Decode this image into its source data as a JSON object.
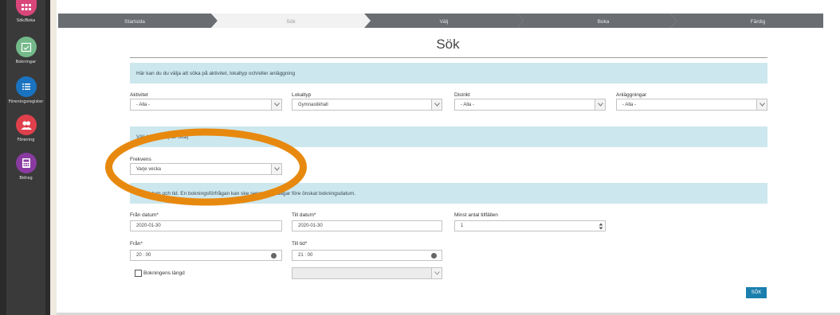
{
  "sidebar": {
    "items": [
      {
        "label": "Sök/Boka",
        "icon": "grid-icon",
        "color": "#d9477a"
      },
      {
        "label": "Bokningar",
        "icon": "calendar-check-icon",
        "color": "#74b98a"
      },
      {
        "label": "Föreningsregister",
        "icon": "list-icon",
        "color": "#1a73c0"
      },
      {
        "label": "Förening",
        "icon": "users-icon",
        "color": "#e0404c"
      },
      {
        "label": "Bidrag",
        "icon": "calculator-icon",
        "color": "#8a3ba1"
      }
    ]
  },
  "wizard": {
    "steps": [
      "Startsida",
      "Sök",
      "Välj",
      "Boka",
      "Färdig"
    ],
    "active_index": 1,
    "colors": {
      "inactive": "#6a6e73",
      "active": "#f2f2f2"
    }
  },
  "page": {
    "title": "Sök"
  },
  "info": {
    "intro": "Här kan du du välja att söka på aktivitet, lokaltyp och/eller anläggning",
    "frequency": "Välj frekvens (hur ofta)",
    "date_time": "Välj datum och tid. En bokningsförfrågan kan ske senast fem dagar före önskat bokningsdatum."
  },
  "filters": {
    "aktivitet": {
      "label": "Aktivitet",
      "value": "- Alla -"
    },
    "lokaltyp": {
      "label": "Lokaltyp",
      "value": "Gymnastikhall"
    },
    "distrikt": {
      "label": "Distrikt",
      "value": "- Alla -"
    },
    "anlaggningar": {
      "label": "Anläggningar",
      "value": "- Alla -"
    }
  },
  "frekvens": {
    "label": "Frekvens",
    "value": "Varje vecka"
  },
  "dates": {
    "from_label": "Från datum*",
    "from_value": "2020-01-30",
    "to_label": "Till datum*",
    "to_value": "2020-01-30",
    "min_label": "Minst antal tillfällen",
    "min_value": "1"
  },
  "times": {
    "from_label": "Från*",
    "from_value": "20 : 00",
    "to_label": "Till tid*",
    "to_value": "21 : 00"
  },
  "length": {
    "checkbox_label": "Bokningens längd",
    "checked": false
  },
  "actions": {
    "search_label": "SÖK"
  },
  "colors": {
    "accent": "#1b7fae",
    "info_band": "#cde7ee",
    "annotation": "#e8890f"
  }
}
